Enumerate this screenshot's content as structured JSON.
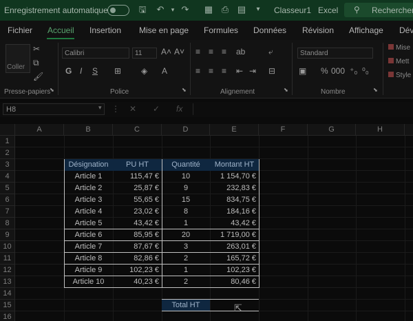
{
  "titlebar": {
    "autosave": "Enregistrement automatique",
    "filename": "Classeur1",
    "app": "Excel",
    "search": "Rechercher"
  },
  "menu": [
    "Fichier",
    "Accueil",
    "Insertion",
    "Mise en page",
    "Formules",
    "Données",
    "Révision",
    "Affichage",
    "Dév"
  ],
  "ribbon": {
    "paste_label": "Coller",
    "font_name": "Calibri",
    "font_size": "11",
    "number_format": "Standard",
    "bold": "G",
    "italic": "I",
    "underline": "S",
    "groups": [
      "Presse-papiers",
      "Police",
      "Alignement",
      "Nombre"
    ],
    "side_items": [
      "Mise",
      "Mett",
      "Style"
    ]
  },
  "formula_bar": {
    "name_box": "H8",
    "fx": "fx",
    "value": ""
  },
  "columns": [
    "A",
    "B",
    "C",
    "D",
    "E",
    "F",
    "G",
    "H"
  ],
  "rows": [
    "1",
    "2",
    "3",
    "4",
    "5",
    "6",
    "7",
    "8",
    "9",
    "10",
    "11",
    "12",
    "13",
    "14",
    "15",
    "16"
  ],
  "table": {
    "headers": [
      "Désignation",
      "PU HT",
      "Quantité",
      "Montant HT"
    ],
    "rows": [
      [
        "Article 1",
        "115,47 €",
        "10",
        "1 154,70 €"
      ],
      [
        "Article 2",
        "25,87 €",
        "9",
        "232,83 €"
      ],
      [
        "Article 3",
        "55,65 €",
        "15",
        "834,75 €"
      ],
      [
        "Article 4",
        "23,02 €",
        "8",
        "184,16 €"
      ],
      [
        "Article 5",
        "43,42 €",
        "1",
        "43,42 €"
      ],
      [
        "Article 6",
        "85,95 €",
        "20",
        "1 719,00 €"
      ],
      [
        "Article 7",
        "87,67 €",
        "3",
        "263,01 €"
      ],
      [
        "Article 8",
        "82,86 €",
        "2",
        "165,72 €"
      ],
      [
        "Article 9",
        "102,23 €",
        "1",
        "102,23 €"
      ],
      [
        "Article 10",
        "40,23 €",
        "2",
        "80,46 €"
      ]
    ],
    "total_label": "Total HT",
    "total_value": ""
  },
  "colors": {
    "titlebar_bg": "#10361f",
    "accent_green": "#1f7a3f",
    "header_fill": "#0f2740"
  }
}
